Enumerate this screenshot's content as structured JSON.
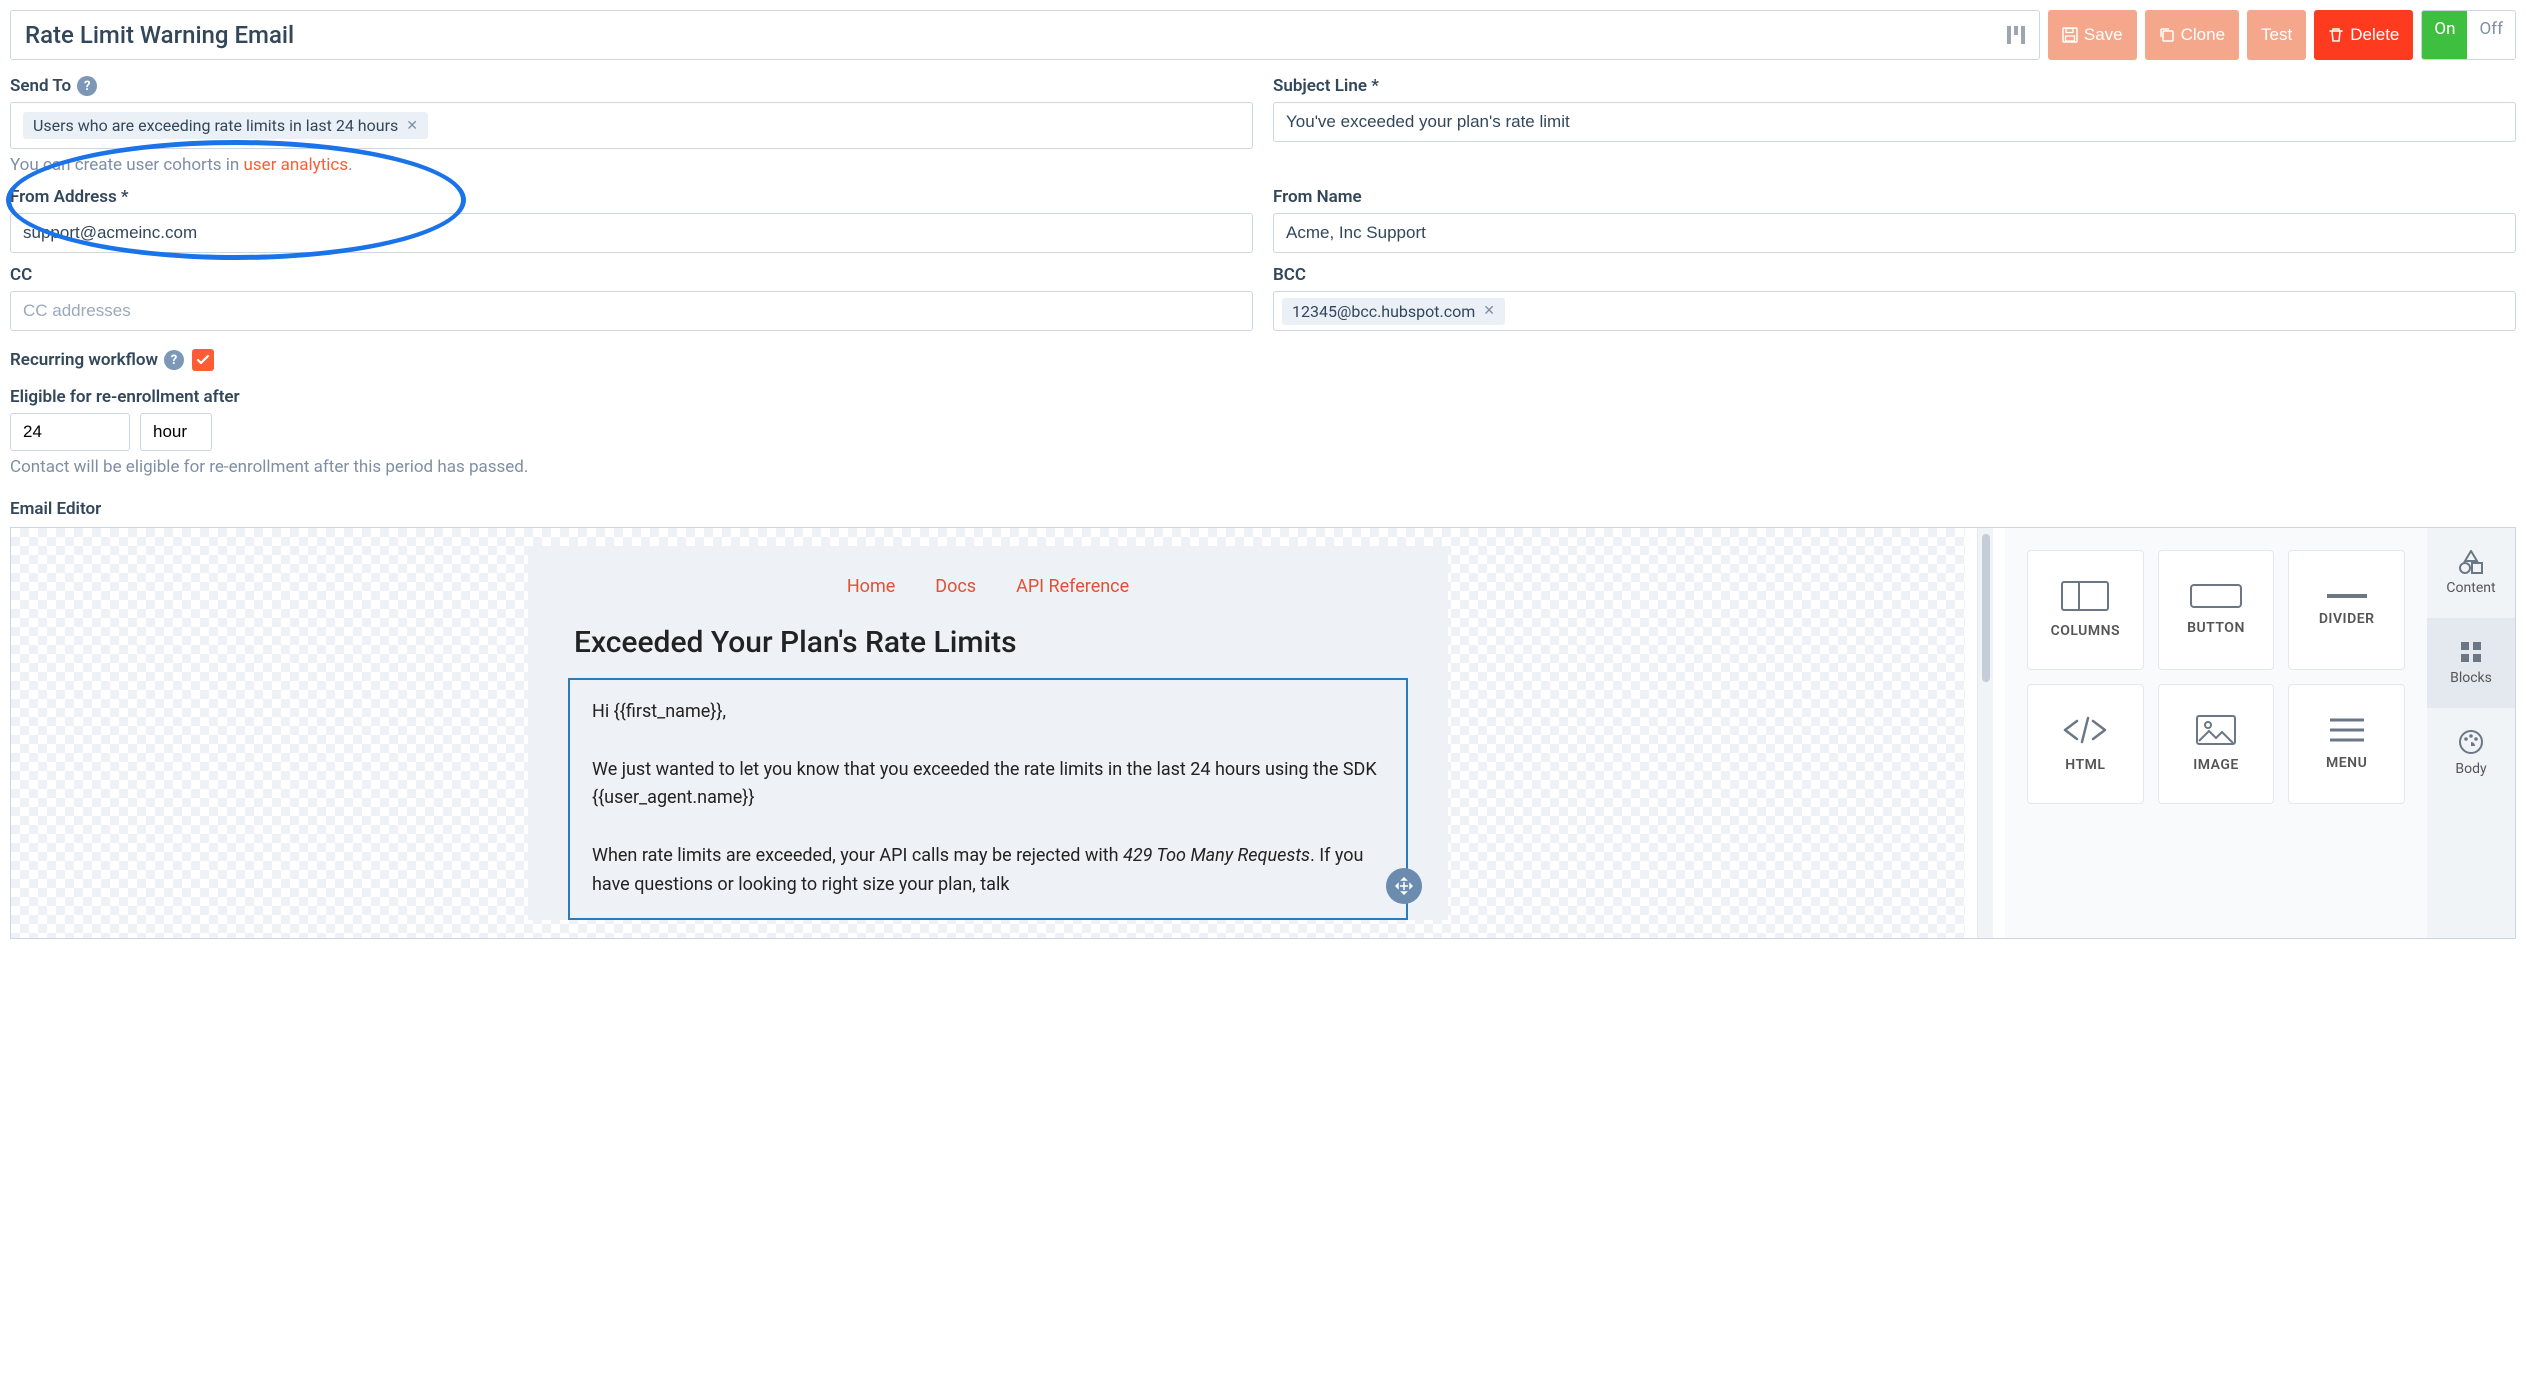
{
  "header": {
    "title": "Rate Limit Warning Email",
    "buttons": {
      "save": "Save",
      "clone": "Clone",
      "test": "Test",
      "delete": "Delete"
    },
    "toggle": {
      "on": "On",
      "off": "Off"
    }
  },
  "fields": {
    "send_to": {
      "label": "Send To",
      "chip": "Users who are exceeding rate limits in last 24 hours",
      "hint_prefix": "You can create user cohorts in ",
      "hint_link": "user analytics",
      "hint_suffix": "."
    },
    "subject": {
      "label": "Subject Line *",
      "value": "You've exceeded your plan's rate limit"
    },
    "from_address": {
      "label": "From Address *",
      "value": "support@acmeinc.com"
    },
    "from_name": {
      "label": "From Name",
      "value": "Acme, Inc Support"
    },
    "cc": {
      "label": "CC",
      "placeholder": "CC addresses"
    },
    "bcc": {
      "label": "BCC",
      "chip": "12345@bcc.hubspot.com"
    },
    "recurring": {
      "label": "Recurring workflow"
    },
    "reenroll": {
      "label": "Eligible for re-enrollment after",
      "value": "24",
      "unit": "hour",
      "hint": "Contact will be eligible for re-enrollment after this period has passed."
    }
  },
  "editor": {
    "label": "Email Editor",
    "nav": [
      "Home",
      "Docs",
      "API Reference"
    ],
    "title": "Exceeded Your Plan's Rate Limits",
    "body_lines": {
      "greeting": "Hi {{first_name}},",
      "p1": "We just wanted to let you know that you exceeded the rate limits in the last 24 hours using the SDK {{user_agent.name}}",
      "p2_a": "When rate limits are exceeded, your API calls may be rejected with ",
      "p2_em": "429 Too Many Requests",
      "p2_b": ". If you have questions or looking to right size your plan, talk"
    },
    "tiles": [
      "COLUMNS",
      "BUTTON",
      "DIVIDER",
      "HTML",
      "IMAGE",
      "MENU"
    ],
    "side_tabs": [
      "Content",
      "Blocks",
      "Body"
    ]
  }
}
